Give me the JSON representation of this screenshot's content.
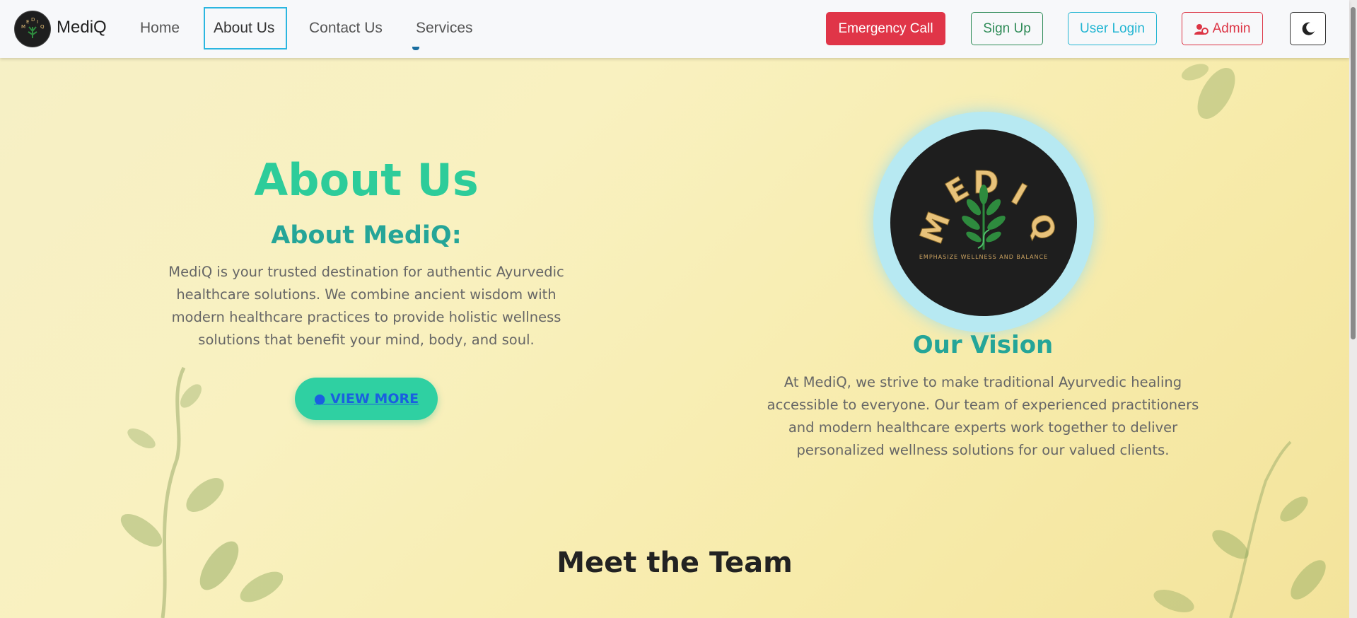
{
  "navbar": {
    "brand": "MediQ",
    "links": [
      {
        "label": "Home"
      },
      {
        "label": "About Us"
      },
      {
        "label": "Contact Us"
      },
      {
        "label": "Services"
      }
    ],
    "emergency_label": "Emergency Call",
    "signup_label": "Sign Up",
    "login_label": "User Login",
    "admin_label": "Admin",
    "theme_icon": "moon-icon"
  },
  "about": {
    "title": "About Us",
    "subtitle": "About MediQ:",
    "text": "MediQ is your trusted destination for authentic Ayurvedic healthcare solutions. We combine ancient wisdom with modern healthcare practices to provide holistic wellness solutions that benefit your mind, body, and soul.",
    "button_label": "● VIEW MORE"
  },
  "vision": {
    "logo_letters": [
      "M",
      "E",
      "D",
      "I",
      "Q"
    ],
    "logo_tagline": "EMPHASIZE WELLNESS AND BALANCE",
    "title": "Our Vision",
    "text": "At MediQ, we strive to make traditional Ayurvedic healing accessible to everyone. Our team of experienced practitioners and modern healthcare experts work together to deliver personalized wellness solutions for our valued clients."
  },
  "team": {
    "title": "Meet the Team"
  },
  "colors": {
    "accent": "#2dcc9a",
    "heading_teal": "#25a598",
    "emergency": "#e03548",
    "logo_gold": "#e8c27a",
    "logo_green": "#2e8b3e"
  }
}
